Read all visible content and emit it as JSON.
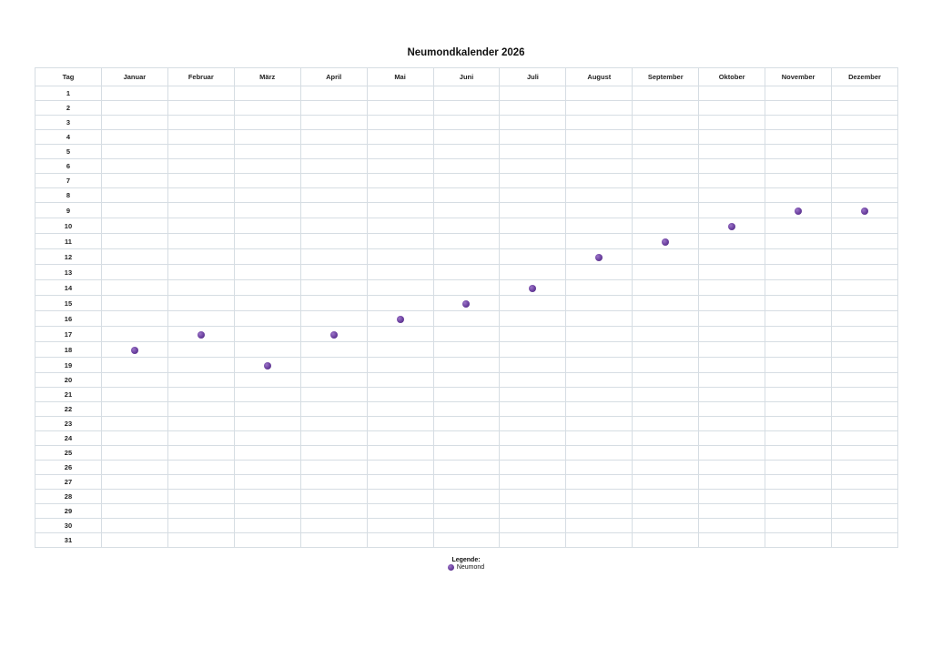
{
  "title": "Neumondkalender 2026",
  "header": {
    "day_label": "Tag",
    "months": [
      "Januar",
      "Februar",
      "März",
      "April",
      "Mai",
      "Juni",
      "Juli",
      "August",
      "September",
      "Oktober",
      "November",
      "Dezember"
    ]
  },
  "days": [
    "1",
    "2",
    "3",
    "4",
    "5",
    "6",
    "7",
    "8",
    "9",
    "10",
    "11",
    "12",
    "13",
    "14",
    "15",
    "16",
    "17",
    "18",
    "19",
    "20",
    "21",
    "22",
    "23",
    "24",
    "25",
    "26",
    "27",
    "28",
    "29",
    "30",
    "31"
  ],
  "new_moons": [
    {
      "month": "Januar",
      "day": 18
    },
    {
      "month": "Februar",
      "day": 17
    },
    {
      "month": "März",
      "day": 19
    },
    {
      "month": "April",
      "day": 17
    },
    {
      "month": "Mai",
      "day": 16
    },
    {
      "month": "Juni",
      "day": 15
    },
    {
      "month": "Juli",
      "day": 14
    },
    {
      "month": "August",
      "day": 12
    },
    {
      "month": "September",
      "day": 11
    },
    {
      "month": "Oktober",
      "day": 10
    },
    {
      "month": "November",
      "day": 9
    },
    {
      "month": "Dezember",
      "day": 9
    }
  ],
  "legend": {
    "title": "Legende:",
    "items": [
      {
        "label": "Neumond",
        "icon": "new-moon-dot-icon",
        "color": "#6a3f9e"
      }
    ]
  }
}
